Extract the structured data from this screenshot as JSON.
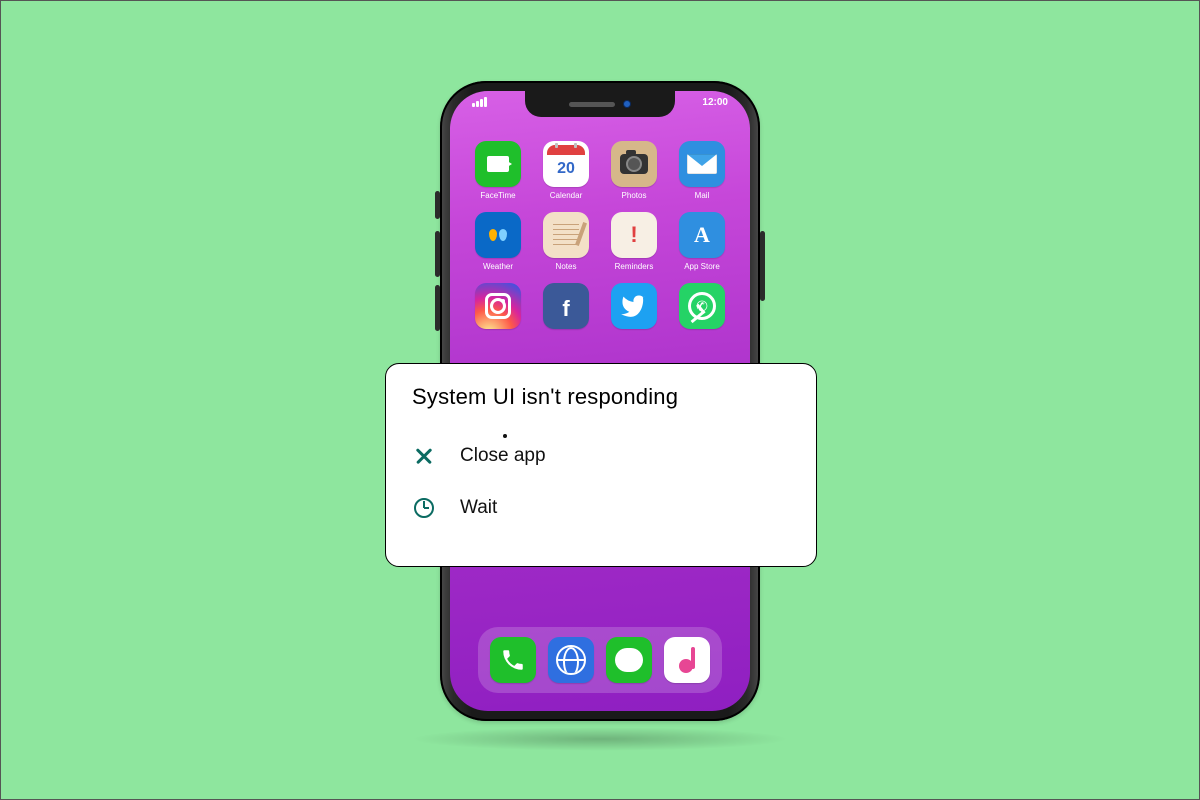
{
  "status_bar": {
    "time": "12:00"
  },
  "calendar_day": "20",
  "apps": {
    "row1": [
      {
        "label": "FaceTime",
        "bg": "#1fbf2b"
      },
      {
        "label": "Calendar",
        "bg": "#ffffff"
      },
      {
        "label": "Photos",
        "bg": "#d6b78a"
      },
      {
        "label": "Mail",
        "bg": "#2f8fe0"
      }
    ],
    "row2": [
      {
        "label": "Weather",
        "bg": "#0a69c7"
      },
      {
        "label": "Notes",
        "bg": "#f3e0c7"
      },
      {
        "label": "Reminders",
        "bg": "#f7efe4"
      },
      {
        "label": "App Store",
        "bg": "#2f8fe0"
      }
    ],
    "row3": [
      {
        "label": "",
        "bg": "#ffffff"
      },
      {
        "label": "",
        "bg": "#3b5998"
      },
      {
        "label": "",
        "bg": "#1da1f2"
      },
      {
        "label": "",
        "bg": "#25d366"
      }
    ]
  },
  "dock": [
    {
      "name": "phone",
      "bg": "#1fbf2b"
    },
    {
      "name": "safari",
      "bg": "#2f6fe0"
    },
    {
      "name": "messages",
      "bg": "#1fbf2b"
    },
    {
      "name": "music",
      "bg": "#ffffff"
    }
  ],
  "dialog": {
    "title": "System UI isn't responding",
    "options": {
      "close": "Close app",
      "wait": "Wait"
    }
  },
  "colors": {
    "accent_teal": "#0b6b62"
  }
}
